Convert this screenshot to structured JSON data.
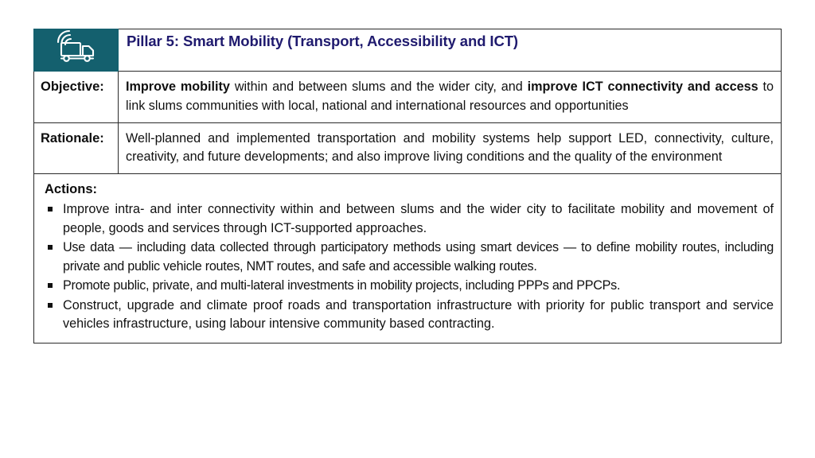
{
  "slide": {
    "background": "#ffffff",
    "accent_teal": "#14606E",
    "title_color": "#1F1A6E",
    "text_color": "#111111"
  },
  "header": {
    "icon": "truck-wifi-icon",
    "title": "Pillar 5: Smart Mobility (Transport, Accessibility and ICT)"
  },
  "rows": [
    {
      "label": "Objective:",
      "text_html": "<b>Improve mobility</b> within and between slums and the wider city, and <b>improve ICT connectivity and access</b> to link slums communities with local, national and international resources and opportunities",
      "text_plain": "Improve mobility within and between slums and the wider city, and improve ICT connectivity and access to link slums communities with local, national and international resources and opportunities"
    },
    {
      "label": "Rationale:",
      "text_html": "Well-planned and implemented transportation and mobility systems help support LED, connectivity, culture, creativity, and future developments; and also improve living conditions and the quality of the environment",
      "text_plain": "Well-planned and implemented transportation and mobility systems help support LED, connectivity, culture, creativity, and future developments; and also improve living conditions and the quality of the environment"
    }
  ],
  "actions": {
    "heading": "Actions:",
    "bullet_glyph": "square",
    "items": [
      {
        "text": "Improve intra- and inter connectivity within and between slums and the wider city to facilitate mobility and movement of people, goods and services through ICT-supported approaches.",
        "condensed": false
      },
      {
        "text": "Use data — including data collected through participatory methods using smart devices — to define mobility routes, including private and public vehicle routes, NMT routes, and safe and accessible walking routes.",
        "condensed": true
      },
      {
        "text": "Promote public, private, and multi-lateral investments in mobility projects, including PPPs and PPCPs.",
        "condensed": true
      },
      {
        "text": "Construct, upgrade and climate proof roads and transportation infrastructure with priority for public transport and service vehicles infrastructure, using labour intensive community based contracting.",
        "condensed": false
      }
    ]
  }
}
